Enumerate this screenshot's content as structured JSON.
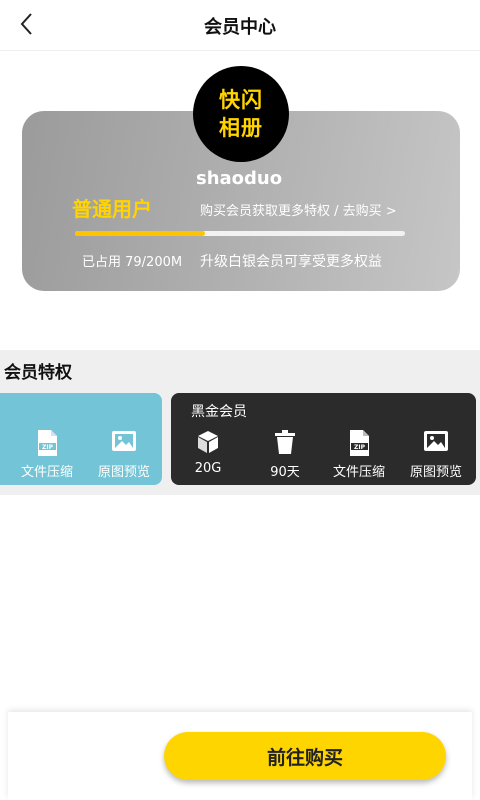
{
  "header": {
    "title": "会员中心"
  },
  "logo": {
    "line1": "快闪",
    "line2": "相册"
  },
  "user": {
    "name": "shaoduo",
    "level": "普通用户",
    "buy_link": "购买会员获取更多特权 / 去购买 >",
    "usage": "已占用 79/200M",
    "upgrade_tip": "升级白银会员可享受更多权益",
    "storage_used_fraction": 0.395
  },
  "privileges": {
    "title": "会员特权",
    "plans": [
      {
        "name": "",
        "features": [
          {
            "label": "文件压缩",
            "icon": "zip-file-icon"
          },
          {
            "label": "原图预览",
            "icon": "image-icon"
          }
        ]
      },
      {
        "name": "黑金会员",
        "features": [
          {
            "label": "20G",
            "icon": "cube-icon"
          },
          {
            "label": "90天",
            "icon": "trash-icon"
          },
          {
            "label": "文件压缩",
            "icon": "zip-file-icon"
          },
          {
            "label": "原图预览",
            "icon": "image-icon"
          }
        ]
      }
    ]
  },
  "footer": {
    "purchase_label": "前往购买"
  },
  "colors": {
    "accent": "#ffd500",
    "silver_plan": "#72c4d6",
    "black_plan": "#2b2b2b",
    "progress": "#ffc400"
  }
}
